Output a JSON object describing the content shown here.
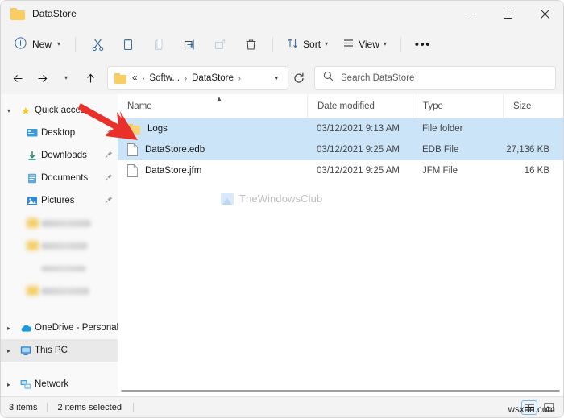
{
  "window": {
    "title": "DataStore",
    "title_icon": "folder-icon",
    "controls": {
      "minimize": "minimize-icon",
      "maximize": "maximize-icon",
      "close": "close-icon"
    }
  },
  "toolbar": {
    "new_label": "New",
    "new_icon": "plus-circle-icon",
    "items": [
      {
        "name": "cut",
        "icon": "scissors-icon",
        "enabled": true
      },
      {
        "name": "copy",
        "icon": "copy-icon",
        "enabled": true
      },
      {
        "name": "paste",
        "icon": "clipboard-icon",
        "enabled": false
      },
      {
        "name": "rename",
        "icon": "rename-icon",
        "enabled": true
      },
      {
        "name": "share",
        "icon": "share-icon",
        "enabled": false
      },
      {
        "name": "delete",
        "icon": "trash-icon",
        "enabled": true
      }
    ],
    "sort_label": "Sort",
    "sort_icon": "sort-arrows-icon",
    "view_label": "View",
    "view_icon": "lines-icon",
    "more_label": "•••"
  },
  "address": {
    "back_icon": "arrow-left-icon",
    "forward_icon": "arrow-right-icon",
    "recent_icon": "chevron-down-icon",
    "up_icon": "arrow-up-icon",
    "breadcrumb_icon": "folder-icon",
    "breadcrumb_overflow": "«",
    "crumbs": [
      "Softw...",
      "DataStore"
    ],
    "dropdown_icon": "chevron-down-icon",
    "refresh_icon": "refresh-icon"
  },
  "search": {
    "icon": "search-icon",
    "placeholder": "Search DataStore",
    "value": ""
  },
  "sidebar": {
    "items": [
      {
        "label": "Quick access",
        "icon": "star-icon",
        "expanded": true,
        "indent": false,
        "pin": false,
        "selected": false,
        "blurred": false
      },
      {
        "label": "Desktop",
        "icon": "desktop-icon",
        "indent": true,
        "pin": true,
        "selected": false,
        "blurred": false
      },
      {
        "label": "Downloads",
        "icon": "download-icon",
        "indent": true,
        "pin": true,
        "selected": false,
        "blurred": false
      },
      {
        "label": "Documents",
        "icon": "documents-icon",
        "indent": true,
        "pin": true,
        "selected": false,
        "blurred": false
      },
      {
        "label": "Pictures",
        "icon": "pictures-icon",
        "indent": true,
        "pin": true,
        "selected": false,
        "blurred": false
      },
      {
        "label": "",
        "icon": "folder-icon",
        "indent": true,
        "pin": false,
        "selected": false,
        "blurred": true,
        "blur_width": 62
      },
      {
        "label": "",
        "icon": "folder-icon",
        "indent": true,
        "pin": false,
        "selected": false,
        "blurred": true,
        "blur_width": 58
      },
      {
        "label": "",
        "icon": "none",
        "indent": true,
        "pin": false,
        "selected": false,
        "blurred": true,
        "blur_width": 56
      },
      {
        "label": "",
        "icon": "folder-icon",
        "indent": true,
        "pin": false,
        "selected": false,
        "blurred": true,
        "blur_width": 60
      },
      {
        "label": "OneDrive - Personal",
        "icon": "cloud-icon",
        "expandable": true,
        "indent": false,
        "pin": false,
        "selected": false,
        "blurred": false
      },
      {
        "label": "This PC",
        "icon": "pc-icon",
        "expandable": true,
        "indent": false,
        "pin": false,
        "selected": true,
        "blurred": false
      },
      {
        "label": "Network",
        "icon": "network-icon",
        "expandable": true,
        "indent": false,
        "pin": false,
        "selected": false,
        "blurred": false
      }
    ]
  },
  "filelist": {
    "columns": [
      {
        "key": "name",
        "label": "Name",
        "sorted": "asc"
      },
      {
        "key": "date",
        "label": "Date modified"
      },
      {
        "key": "type",
        "label": "Type"
      },
      {
        "key": "size",
        "label": "Size"
      }
    ],
    "rows": [
      {
        "name": "Logs",
        "date": "03/12/2021 9:13 AM",
        "type": "File folder",
        "size": "",
        "icon": "folder-icon",
        "selected": true
      },
      {
        "name": "DataStore.edb",
        "date": "03/12/2021 9:25 AM",
        "type": "EDB File",
        "size": "27,136 KB",
        "icon": "file-icon",
        "selected": true
      },
      {
        "name": "DataStore.jfm",
        "date": "03/12/2021 9:25 AM",
        "type": "JFM File",
        "size": "16 KB",
        "icon": "file-icon",
        "selected": false
      }
    ]
  },
  "watermark": {
    "text": "TheWindowsClub",
    "icon": "image-icon"
  },
  "statusbar": {
    "item_count": "3 items",
    "selection_count": "2 items selected",
    "view_details_icon": "details-view-icon",
    "view_large_icon": "large-icons-view-icon"
  },
  "overlay": {
    "corner_text": "wsxdn.com",
    "annotation": "red-arrow"
  },
  "colors": {
    "selection": "#cce4f7",
    "accent": "#0067c0",
    "folder": "#f9cd62",
    "arrow": "#e8312a",
    "chrome": "#f3f3f3"
  }
}
